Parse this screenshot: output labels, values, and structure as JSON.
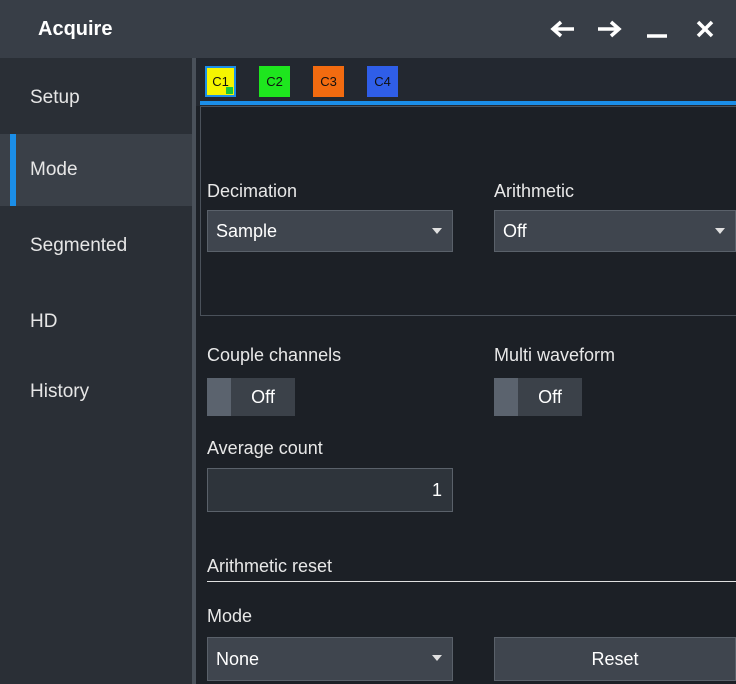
{
  "window": {
    "title": "Acquire",
    "controls": [
      {
        "icon": "arrow-left-icon"
      },
      {
        "icon": "arrow-right-icon"
      },
      {
        "icon": "minimize-icon"
      },
      {
        "icon": "close-icon"
      }
    ]
  },
  "sidebar": {
    "items": [
      {
        "label": "Setup",
        "active": false
      },
      {
        "label": "Mode",
        "active": true
      },
      {
        "label": "Segmented",
        "active": false
      },
      {
        "label": "HD",
        "active": false
      },
      {
        "label": "History",
        "active": false
      }
    ]
  },
  "channel_tabs": [
    {
      "label": "C1",
      "color": "#f5f500",
      "active": true
    },
    {
      "label": "C2",
      "color": "#1ee61e",
      "active": false
    },
    {
      "label": "C3",
      "color": "#f26b10",
      "active": false
    },
    {
      "label": "C4",
      "color": "#2f5ee8",
      "active": false
    }
  ],
  "colors": {
    "accent": "#1b8ee8",
    "background": "#1c2026",
    "sidebar": "#2a2f36"
  },
  "mode": {
    "decimation": {
      "label": "Decimation",
      "value": "Sample"
    },
    "arithmetic": {
      "label": "Arithmetic",
      "value": "Off"
    },
    "couple_channels": {
      "label": "Couple channels",
      "state": "Off"
    },
    "multi_waveform": {
      "label": "Multi waveform",
      "state": "Off"
    },
    "average_count": {
      "label": "Average count",
      "value": "1"
    }
  },
  "arithmetic_reset": {
    "heading": "Arithmetic reset",
    "mode_label": "Mode",
    "mode_value": "None",
    "reset_label": "Reset"
  }
}
